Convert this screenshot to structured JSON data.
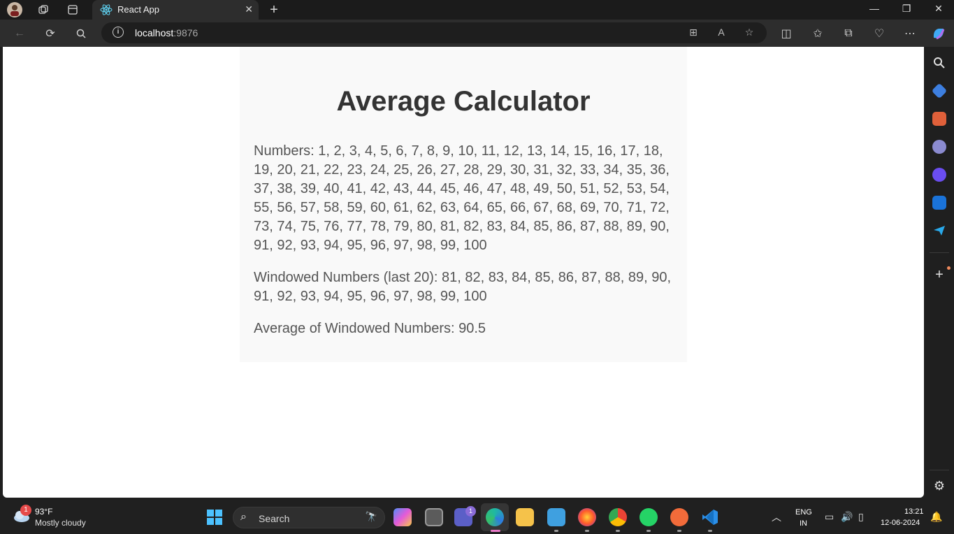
{
  "browser": {
    "tab_title": "React App",
    "url_host": "localhost",
    "url_port": ":9876"
  },
  "page": {
    "title": "Average Calculator",
    "numbers_label": "Numbers: 1, 2, 3, 4, 5, 6, 7, 8, 9, 10, 11, 12, 13, 14, 15, 16, 17, 18, 19, 20, 21, 22, 23, 24, 25, 26, 27, 28, 29, 30, 31, 32, 33, 34, 35, 36, 37, 38, 39, 40, 41, 42, 43, 44, 45, 46, 47, 48, 49, 50, 51, 52, 53, 54, 55, 56, 57, 58, 59, 60, 61, 62, 63, 64, 65, 66, 67, 68, 69, 70, 71, 72, 73, 74, 75, 76, 77, 78, 79, 80, 81, 82, 83, 84, 85, 86, 87, 88, 89, 90, 91, 92, 93, 94, 95, 96, 97, 98, 99, 100",
    "windowed_label": "Windowed Numbers (last 20): 81, 82, 83, 84, 85, 86, 87, 88, 89, 90, 91, 92, 93, 94, 95, 96, 97, 98, 99, 100",
    "average_label": "Average of Windowed Numbers: 90.5"
  },
  "taskbar": {
    "weather_temp": "93°F",
    "weather_condition": "Mostly cloudy",
    "weather_badge": "1",
    "search_placeholder": "Search",
    "teams_badge": "1",
    "lang_line1": "ENG",
    "lang_line2": "IN",
    "time": "13:21",
    "date": "12-06-2024"
  },
  "colors": {
    "card_bg": "#f9f9f9",
    "title_text": "#333333",
    "body_text": "#555555",
    "accent": "#4cc2ff"
  }
}
